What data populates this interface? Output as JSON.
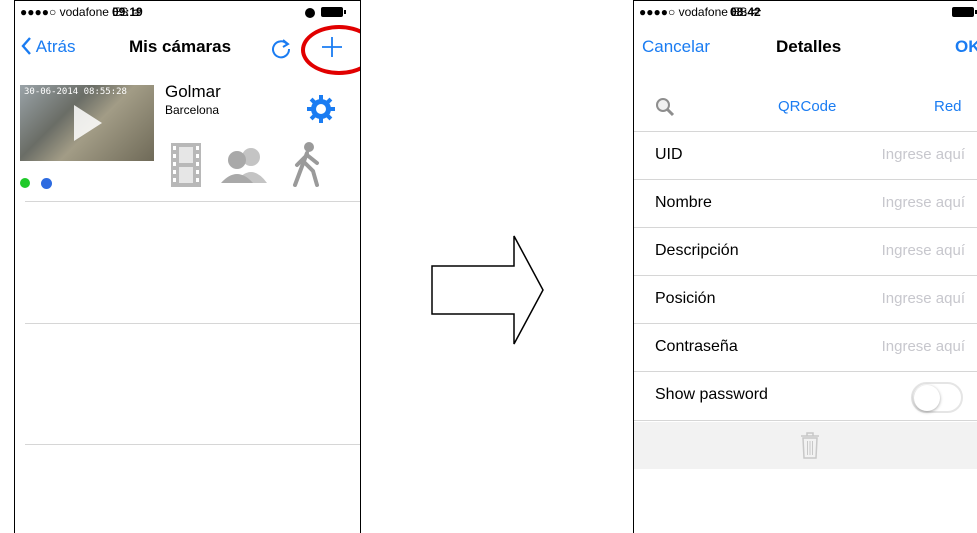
{
  "left": {
    "status": {
      "carrier": "●●●●○ vodafone ES",
      "wifi": "ᯤ",
      "time": "09:19"
    },
    "nav": {
      "back_label": "Atrás",
      "title": "Mis cámaras"
    },
    "camera": {
      "name": "Golmar",
      "location": "Barcelona",
      "timestamp": "30-06-2014 08:55:28"
    }
  },
  "right": {
    "status": {
      "carrier": "●●●●○ vodafone ES",
      "wifi": "ᯤ",
      "time": "08:42"
    },
    "nav": {
      "cancel_label": "Cancelar",
      "title": "Detalles",
      "ok_label": "OK"
    },
    "search_row": {
      "qrcode_label": "QRCode",
      "red_label": "Red"
    },
    "fields": [
      {
        "label": "UID",
        "placeholder": "Ingrese aquí"
      },
      {
        "label": "Nombre",
        "placeholder": "Ingrese aquí"
      },
      {
        "label": "Descripción",
        "placeholder": "Ingrese aquí"
      },
      {
        "label": "Posición",
        "placeholder": "Ingrese aquí"
      },
      {
        "label": "Contraseña",
        "placeholder": "Ingrese aquí"
      }
    ],
    "show_password": {
      "label": "Show password",
      "value": false
    }
  },
  "colors": {
    "ios_blue": "#1a7cf2",
    "highlight_red": "#e10000",
    "online_green": "#1fc92a"
  },
  "icons": [
    "refresh-icon",
    "plus-icon",
    "gear-icon",
    "film-icon",
    "users-icon",
    "walking-icon",
    "search-icon",
    "trash-icon",
    "arrow-right-icon"
  ]
}
